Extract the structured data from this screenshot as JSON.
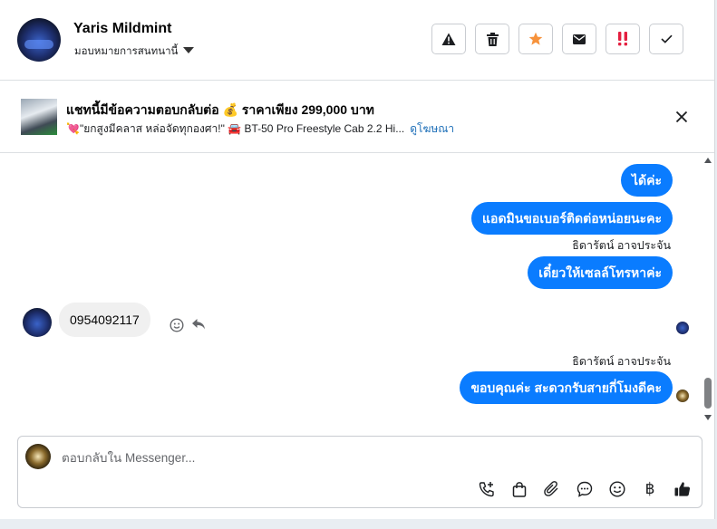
{
  "header": {
    "name": "Yaris Mildmint",
    "assign_label": "มอบหมายการสนทนานี้",
    "actions": [
      "spam-warning-icon",
      "trash-icon",
      "star-icon",
      "mail-icon",
      "priority-icon",
      "check-icon"
    ]
  },
  "ad": {
    "title": "แชทนี้มีข้อความตอบกลับต่อ 💰 ราคาเพียง 299,000 บาท",
    "subtitle": "💘\"ยกสูงมีคลาส หล่อจัดทุกองศา!\" 🚘 BT-50 Pro Freestyle Cab 2.2 Hi...",
    "link_label": "ดูโฆษณา"
  },
  "messages": [
    {
      "from": "me",
      "text": "ได้ค่ะ"
    },
    {
      "from": "me",
      "text": "แอดมินขอเบอร์ติดต่อหน่อยนะคะ"
    },
    {
      "from": "me",
      "sender": "ธิดารัตน์ อาจประจัน",
      "text": "เดี๋ยวให้เซลล์โทรหาค่ะ"
    },
    {
      "from": "them",
      "text": "0954092117"
    },
    {
      "from": "me",
      "sender": "ธิดารัตน์ อาจประจัน",
      "text": "ขอบคุณค่ะ สะดวกรับสายกี่โมงดีคะ"
    }
  ],
  "composer": {
    "placeholder": "ตอบกลับใน Messenger...",
    "tools": [
      "call-add-icon",
      "shopping-bag-icon",
      "attachment-icon",
      "chat-bubble-icon",
      "emoji-icon",
      "baht-icon",
      "thumbs-up-icon"
    ]
  },
  "colors": {
    "accent": "#0a7cff",
    "priority": "#e41e3f",
    "star": "#f7923b"
  }
}
